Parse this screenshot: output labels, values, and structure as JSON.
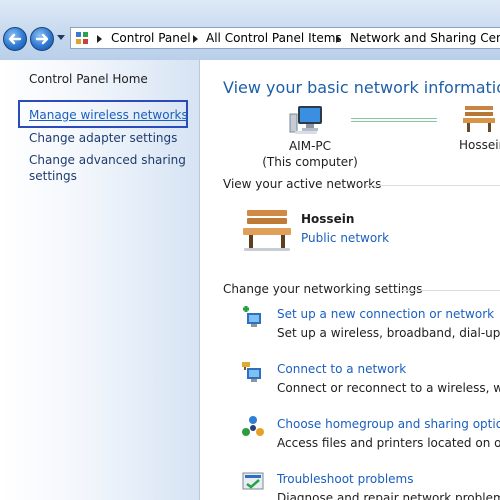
{
  "breadcrumb": {
    "items": [
      "Control Panel",
      "All Control Panel Items",
      "Network and Sharing Center"
    ]
  },
  "left_pane": {
    "home": "Control Panel Home",
    "links": [
      {
        "label": "Manage wireless networks"
      },
      {
        "label": "Change adapter settings"
      },
      {
        "label": "Change advanced sharing settings"
      }
    ]
  },
  "main": {
    "heading": "View your basic network information an",
    "computer_name": "AIM-PC",
    "computer_sub": "(This computer)",
    "network_partial_name": "Hossein",
    "active_section": "View your active networks",
    "active_network": {
      "name": "Hossein",
      "type": "Public network"
    },
    "change_section": "Change your networking settings",
    "tasks": [
      {
        "title": "Set up a new connection or network",
        "desc": "Set up a wireless, broadband, dial-up, ad h",
        "icon": "new-connection-icon"
      },
      {
        "title": "Connect to a network",
        "desc": "Connect or reconnect to a wireless, wired,",
        "icon": "connect-network-icon"
      },
      {
        "title": "Choose homegroup and sharing options",
        "desc": "Access files and printers located on other n",
        "icon": "homegroup-icon"
      },
      {
        "title": "Troubleshoot problems",
        "desc": "Diagnose and repair network problems, or g",
        "icon": "troubleshoot-icon"
      }
    ]
  },
  "colors": {
    "link": "#1a5fbf",
    "heading": "#1d5fa8",
    "highlight_box": "#2b4bbd"
  }
}
